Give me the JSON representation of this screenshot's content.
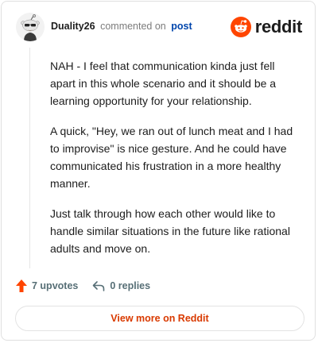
{
  "comment": {
    "username": "Duality26",
    "action_text": "commented on",
    "post_link_label": "post",
    "paragraphs": [
      "NAH - I feel that communication kinda just fell apart in this whole scenario and it should be a learning opportunity for your relationship.",
      "A quick, \"Hey, we ran out of lunch meat and I had to improvise\" is nice gesture. And he could have communicated his frustration in a more healthy manner.",
      "Just talk through how each other would like to handle similar situations in the future like rational adults and move on."
    ]
  },
  "brand": {
    "wordmark": "reddit",
    "logo_icon": "reddit-snoo-icon",
    "accent": "#ff4500"
  },
  "footer": {
    "upvotes_label": "7 upvotes",
    "upvote_icon": "upvote-arrow-icon",
    "replies_label": "0 replies",
    "reply_icon": "reply-arrow-icon"
  },
  "cta": {
    "label": "View more on Reddit",
    "color": "#d93a00"
  }
}
